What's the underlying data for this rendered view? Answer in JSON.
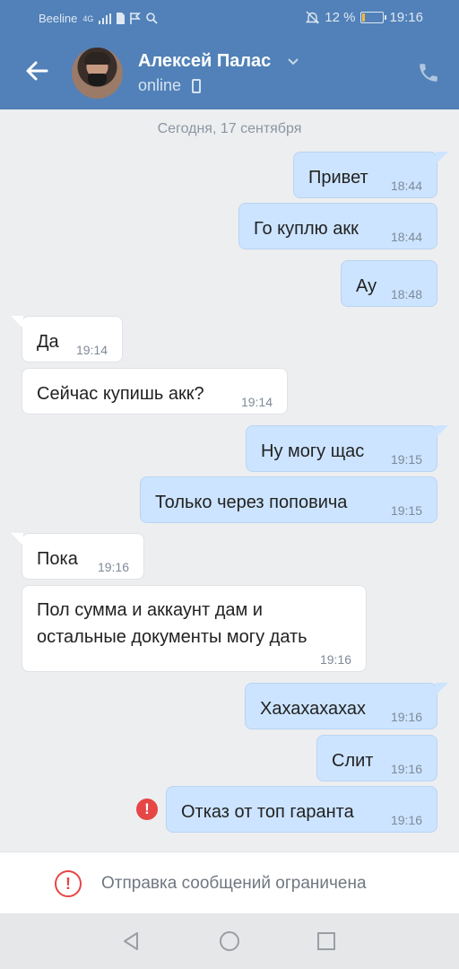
{
  "status_bar": {
    "carrier": "Beeline",
    "network": "4G",
    "battery_percent": "12 %",
    "battery_level": 0.12,
    "time": "19:16"
  },
  "header": {
    "contact_name": "Алексей Палас",
    "presence": "online"
  },
  "date_separator": "Сегодня, 17 сентября",
  "messages": [
    {
      "dir": "out",
      "text": "Привет",
      "time": "18:44"
    },
    {
      "dir": "out",
      "text": "Го куплю акк",
      "time": "18:44"
    },
    {
      "dir": "out",
      "text": "Ау",
      "time": "18:48"
    },
    {
      "dir": "in",
      "text": "Да",
      "time": "19:14"
    },
    {
      "dir": "in",
      "text": "Сейчас купишь акк?",
      "time": "19:14"
    },
    {
      "dir": "out",
      "text": "Ну могу щас",
      "time": "19:15"
    },
    {
      "dir": "out",
      "text": "Только через поповича",
      "time": "19:15"
    },
    {
      "dir": "in",
      "text": "Пока",
      "time": "19:16"
    },
    {
      "dir": "in",
      "text_line1": "Пол сумма и аккаунт дам и",
      "text_line2": "остальные документы могу дать",
      "time": "19:16"
    },
    {
      "dir": "out",
      "text": "Хахахахахах",
      "time": "19:16"
    },
    {
      "dir": "out",
      "text": "Слит",
      "time": "19:16"
    },
    {
      "dir": "out",
      "text": "Отказ от топ гаранта",
      "time": "19:16",
      "failed": true
    }
  ],
  "restriction_notice": "Отправка сообщений ограничена",
  "colors": {
    "header": "#5181b8",
    "outgoing_bubble": "#cce4ff",
    "incoming_bubble": "#ffffff",
    "error": "#e64646"
  }
}
